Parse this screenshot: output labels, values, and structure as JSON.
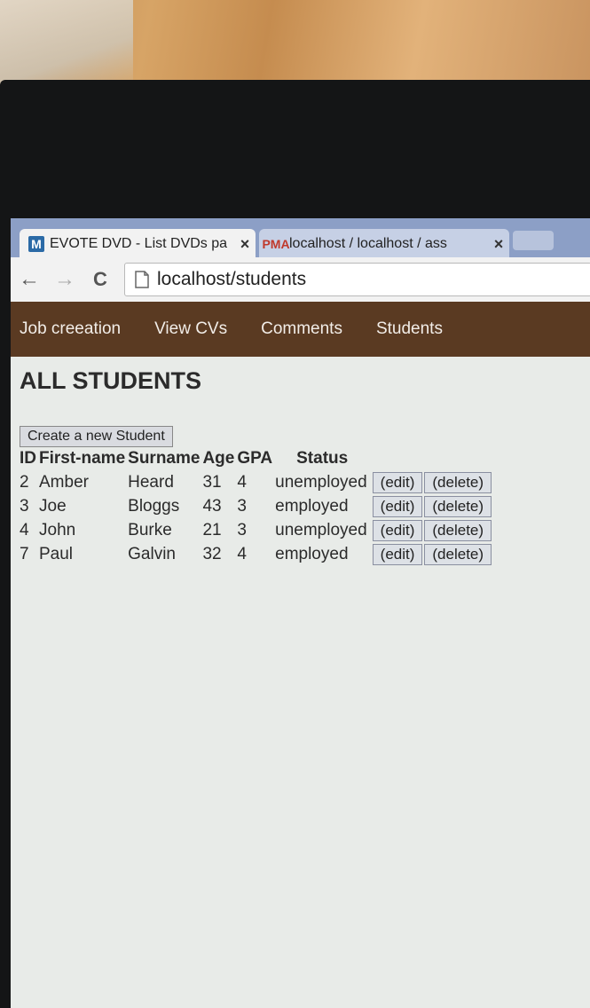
{
  "browser": {
    "tabs": [
      {
        "title": "EVOTE DVD - List DVDs pa",
        "favicon": "M",
        "close": "×"
      },
      {
        "title": "localhost / localhost / ass",
        "favicon": "PMA",
        "close": "×"
      }
    ],
    "url": "localhost/students",
    "nav": {
      "back": "←",
      "forward": "→",
      "reload": "C"
    }
  },
  "site_nav": [
    "Job creeation",
    "View CVs",
    "Comments",
    "Students"
  ],
  "page_title": "ALL STUDENTS",
  "create_button": "Create a new Student",
  "table": {
    "headers": [
      "ID",
      "First-name",
      "Surname",
      "Age",
      "GPA",
      "Status"
    ],
    "rows": [
      {
        "id": "2",
        "first": "Amber",
        "surname": "Heard",
        "age": "31",
        "gpa": "4",
        "status": "unemployed"
      },
      {
        "id": "3",
        "first": "Joe",
        "surname": "Bloggs",
        "age": "43",
        "gpa": "3",
        "status": "employed"
      },
      {
        "id": "4",
        "first": "John",
        "surname": "Burke",
        "age": "21",
        "gpa": "3",
        "status": "unemployed"
      },
      {
        "id": "7",
        "first": "Paul",
        "surname": "Galvin",
        "age": "32",
        "gpa": "4",
        "status": "employed"
      }
    ],
    "edit_label": "(edit)",
    "delete_label": "(delete)"
  },
  "colors": {
    "site_nav_bg": "#5a3a22",
    "tabstrip_bg": "#8c9fc6"
  }
}
